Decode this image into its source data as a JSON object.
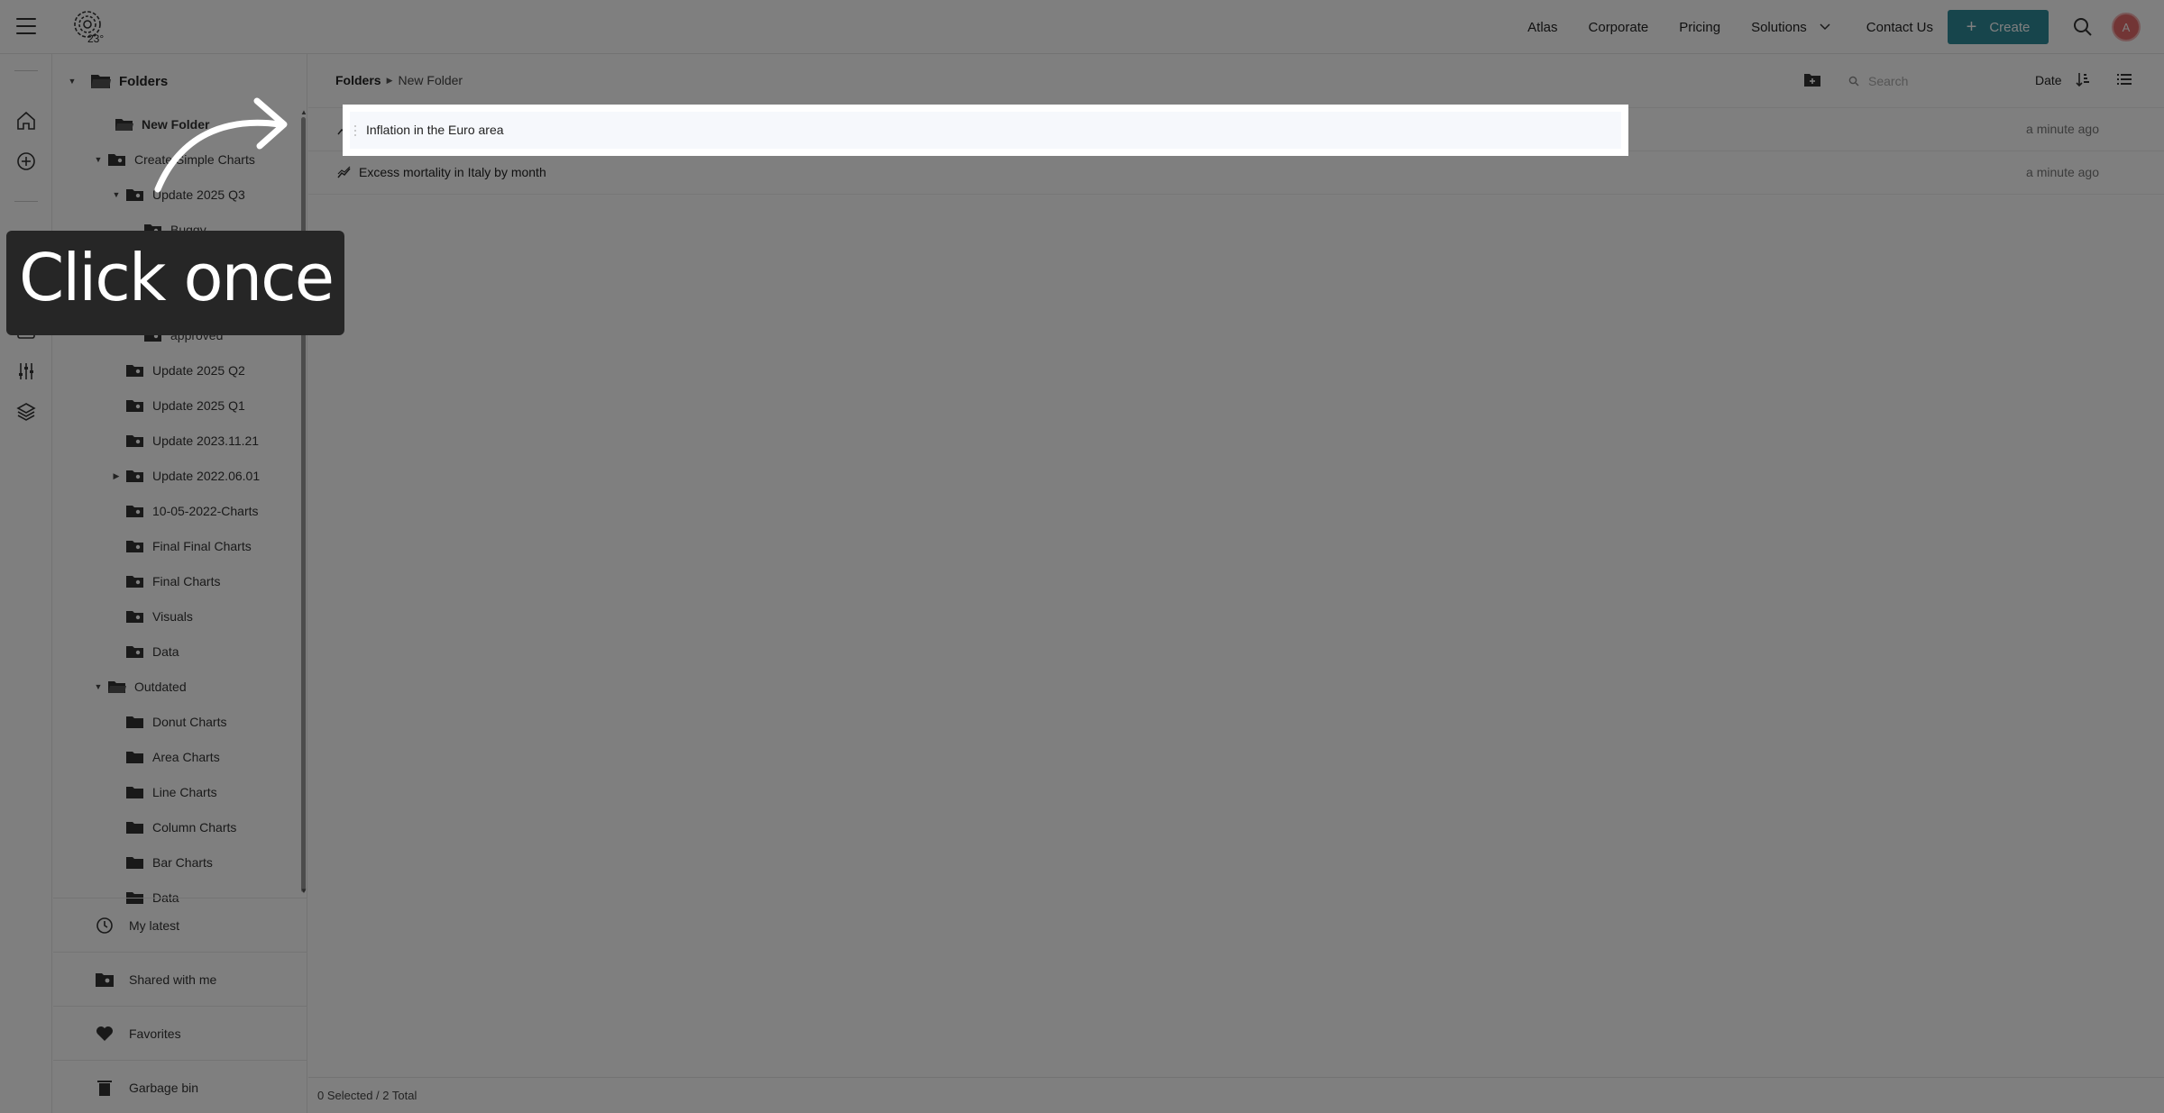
{
  "topbar": {
    "logo_text": "23°",
    "nav": [
      "Atlas",
      "Corporate",
      "Pricing"
    ],
    "solutions_label": "Solutions",
    "contact_label": "Contact Us",
    "create_label": "Create",
    "avatar_initial": "A",
    "accent_color": "#2e8a99"
  },
  "rail": {
    "icons": [
      "home-icon",
      "plus-circle-icon",
      "heart-icon",
      "user-circle-icon",
      "inbox-icon",
      "sliders-icon",
      "layers-icon"
    ]
  },
  "tree": {
    "header_label": "Folders",
    "items": [
      {
        "label": "New Folder"
      },
      {
        "label": "Create Simple Charts"
      },
      {
        "label": "Update 2025 Q3"
      },
      {
        "label": "Buggy"
      },
      {
        "label": "approved"
      },
      {
        "label": "Update 2025 Q2"
      },
      {
        "label": "Update 2025 Q1"
      },
      {
        "label": "Update 2023.11.21"
      },
      {
        "label": "Update 2022.06.01"
      },
      {
        "label": "10-05-2022-Charts"
      },
      {
        "label": "Final Final Charts"
      },
      {
        "label": "Final Charts"
      },
      {
        "label": "Visuals"
      },
      {
        "label": "Data"
      },
      {
        "label": "Outdated"
      },
      {
        "label": "Donut Charts"
      },
      {
        "label": "Area Charts"
      },
      {
        "label": "Line Charts"
      },
      {
        "label": "Column Charts"
      },
      {
        "label": "Bar Charts"
      },
      {
        "label": "Data"
      }
    ],
    "bottom": {
      "latest": "My latest",
      "shared": "Shared with me",
      "favorites": "Favorites",
      "garbage": "Garbage bin"
    }
  },
  "main": {
    "breadcrumb_root": "Folders",
    "breadcrumb_current": "New Folder",
    "search_placeholder": "Search",
    "sort_label": "Date",
    "items": [
      {
        "name": "Inflation in the Euro area",
        "date": "a minute ago"
      },
      {
        "name": "Excess mortality in Italy by month",
        "date": "a minute ago"
      }
    ],
    "status": "0 Selected / 2 Total"
  },
  "overlay": {
    "callout": "Click once"
  }
}
